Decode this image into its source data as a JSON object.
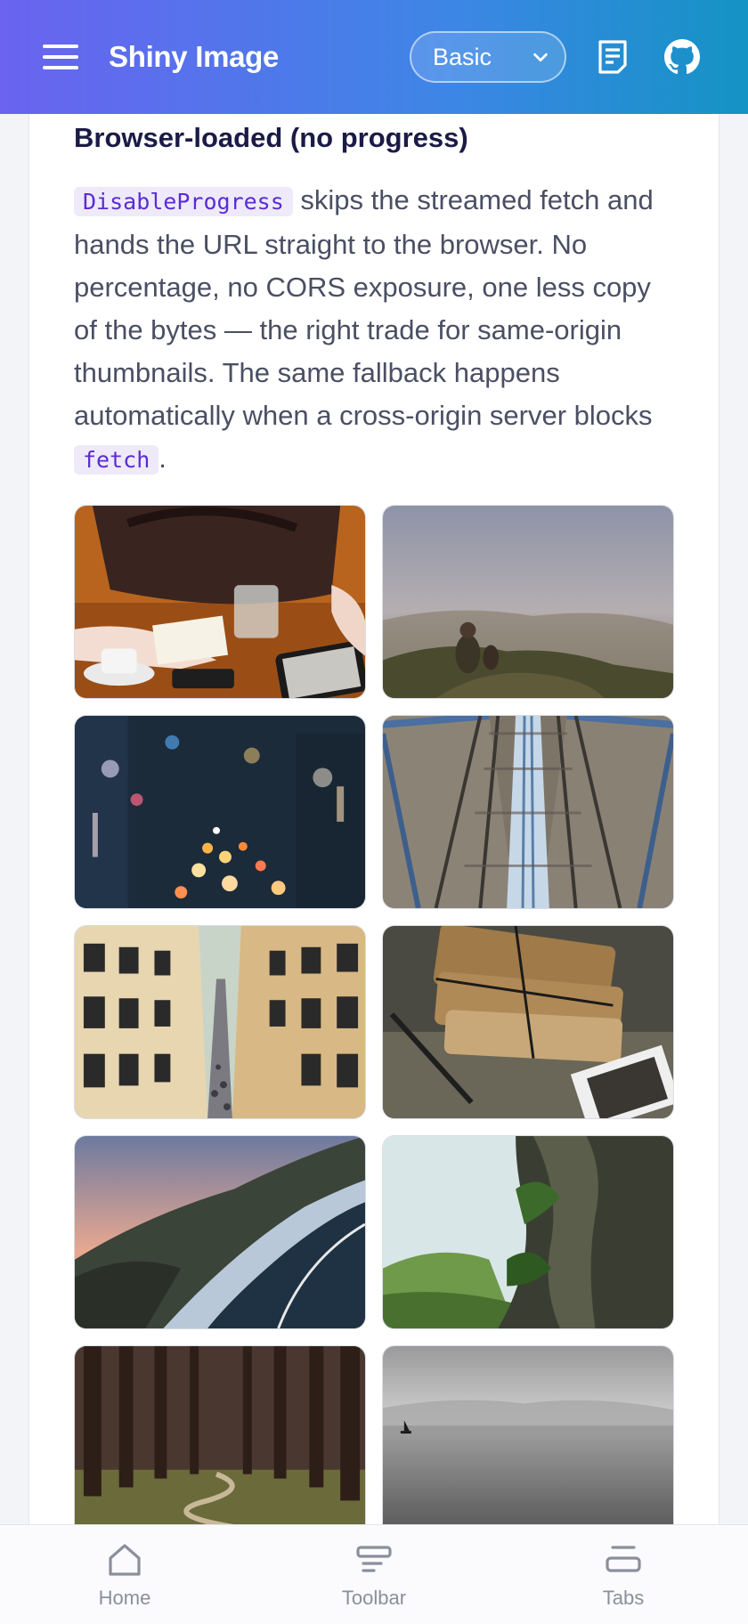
{
  "header": {
    "title": "Shiny Image",
    "mode_select": {
      "value": "Basic"
    },
    "icons": [
      "menu-icon",
      "docs-icon",
      "github-icon"
    ]
  },
  "section": {
    "title": "Browser-loaded (no progress)",
    "desc_code_1": "DisableProgress",
    "desc_text_1": " skips the streamed fetch and hands the URL straight to the browser. No percentage, no CORS exposure, one less copy of the bytes — the right trade for same-origin thumbnails. The same fallback happens automatically when a cross-origin server blocks ",
    "desc_code_2": "fetch",
    "desc_text_2": "."
  },
  "gallery": {
    "count": 10
  },
  "tabbar": {
    "items": [
      {
        "label": "Home",
        "icon": "home-icon"
      },
      {
        "label": "Toolbar",
        "icon": "toolbar-icon"
      },
      {
        "label": "Tabs",
        "icon": "tabs-icon"
      }
    ]
  },
  "colors": {
    "header_gradient_start": "#6a63f0",
    "header_gradient_end": "#1493c4",
    "title_text": "#1a1b46",
    "code_text": "#5b2bd6",
    "code_bg": "#eeeaf9"
  }
}
